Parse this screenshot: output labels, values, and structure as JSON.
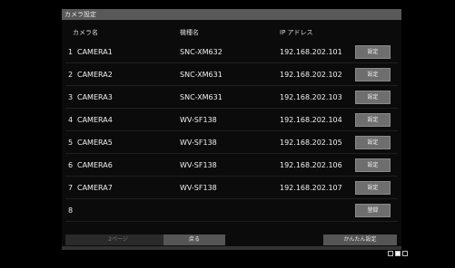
{
  "window": {
    "title": "カメラ設定"
  },
  "table": {
    "headers": {
      "camera_name": "カメラ名",
      "model": "機種名",
      "ip": "IP アドレス"
    },
    "rows": [
      {
        "index": "1",
        "name": "CAMERA1",
        "model": "SNC-XM632",
        "ip": "192.168.202.101",
        "action": "設定"
      },
      {
        "index": "2",
        "name": "CAMERA2",
        "model": "SNC-XM631",
        "ip": "192.168.202.102",
        "action": "設定"
      },
      {
        "index": "3",
        "name": "CAMERA3",
        "model": "SNC-XM631",
        "ip": "192.168.202.103",
        "action": "設定"
      },
      {
        "index": "4",
        "name": "CAMERA4",
        "model": "WV-SF138",
        "ip": "192.168.202.104",
        "action": "設定"
      },
      {
        "index": "5",
        "name": "CAMERA5",
        "model": "WV-SF138",
        "ip": "192.168.202.105",
        "action": "設定"
      },
      {
        "index": "6",
        "name": "CAMERA6",
        "model": "WV-SF138",
        "ip": "192.168.202.106",
        "action": "設定"
      },
      {
        "index": "7",
        "name": "CAMERA7",
        "model": "WV-SF138",
        "ip": "192.168.202.107",
        "action": "設定"
      },
      {
        "index": "8",
        "name": "",
        "model": "",
        "ip": "",
        "action": "登録"
      }
    ]
  },
  "footer": {
    "page_button": "2ページ",
    "back_button": "戻る",
    "easy_setup_button": "かんたん設定"
  },
  "colors": {
    "background": "#000000",
    "panel": "#0b0b0b",
    "titlebar": "#595959",
    "button": "#6e6e6e",
    "text": "#f0f0f0"
  }
}
